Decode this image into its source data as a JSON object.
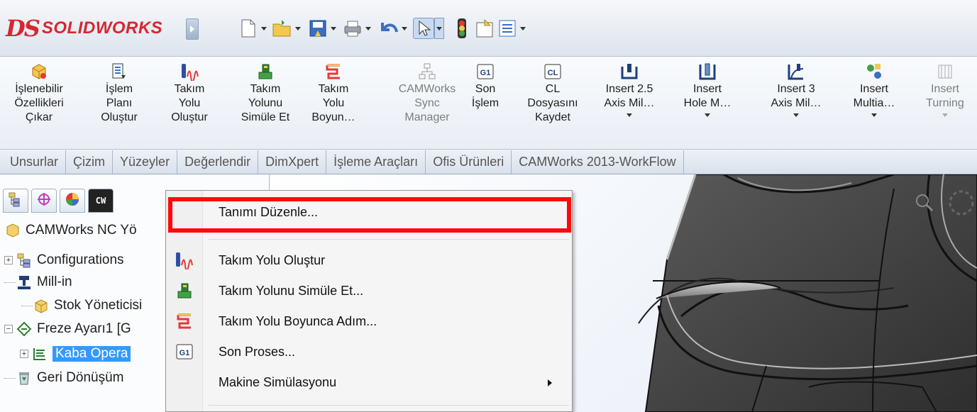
{
  "app": {
    "logo_ds": "DS",
    "logo_brand": "SOLIDWORKS"
  },
  "ribbon": [
    {
      "id": "islenebilir",
      "icon": "extract-features-icon",
      "lines": [
        "İşlenebilir",
        "Özellikleri",
        "Çıkar"
      ],
      "enabled": true
    },
    {
      "id": "islem-plani",
      "icon": "operation-plan-icon",
      "lines": [
        "İşlem",
        "Planı",
        "Oluştur"
      ],
      "enabled": true
    },
    {
      "id": "takim-yolu-olustur",
      "icon": "toolpath-icon",
      "lines": [
        "Takım",
        "Yolu",
        "Oluştur"
      ],
      "enabled": true
    },
    {
      "id": "takim-yolunu-simule",
      "icon": "simulate-toolpath-icon",
      "lines": [
        "Takım",
        "Yolunu",
        "Simüle Et"
      ],
      "enabled": true
    },
    {
      "id": "takim-yolu-boyunca",
      "icon": "step-through-toolpath-icon",
      "lines": [
        "Takım",
        "Yolu",
        "Boyun…"
      ],
      "enabled": true
    },
    {
      "id": "camworks-sync",
      "icon": "sync-manager-icon",
      "lines": [
        "CAMWorks",
        "Sync",
        "Manager"
      ],
      "enabled": false
    },
    {
      "id": "son-islem",
      "icon": "g1-post-process-icon",
      "lines": [
        "Son",
        "İşlem"
      ],
      "enabled": true
    },
    {
      "id": "cl-dosyasi",
      "icon": "cl-file-icon",
      "lines": [
        "CL",
        "Dosyasını",
        "Kaydet"
      ],
      "enabled": true
    },
    {
      "id": "insert-25",
      "icon": "insert-2-5-axis-icon",
      "lines": [
        "Insert 2.5",
        "Axis Mil…"
      ],
      "enabled": true,
      "dropdown": true
    },
    {
      "id": "insert-hole",
      "icon": "insert-hole-icon",
      "lines": [
        "Insert",
        "Hole M…"
      ],
      "enabled": true,
      "dropdown": true
    },
    {
      "id": "insert-3",
      "icon": "insert-3-axis-icon",
      "lines": [
        "Insert 3",
        "Axis Mil…"
      ],
      "enabled": true,
      "dropdown": true
    },
    {
      "id": "insert-multia",
      "icon": "insert-multiaxis-icon",
      "lines": [
        "Insert",
        "Multia…"
      ],
      "enabled": true,
      "dropdown": true
    },
    {
      "id": "insert-turning",
      "icon": "insert-turning-icon",
      "lines": [
        "Insert",
        "Turning"
      ],
      "enabled": false,
      "dropdown": true
    }
  ],
  "tabs": [
    "Unsurlar",
    "Çizim",
    "Yüzeyler",
    "Değerlendir",
    "DimXpert",
    "İşleme Araçları",
    "Ofis Ürünleri",
    "CAMWorks 2013-WorkFlow"
  ],
  "tree": {
    "root": "CAMWorks NC Yö",
    "items": [
      {
        "label": "Configurations",
        "icon": "configurations-icon",
        "expander": "+"
      },
      {
        "label": "Mill-in",
        "icon": "mill-machine-icon",
        "expander": ""
      },
      {
        "label": "Stok Yöneticisi",
        "icon": "stock-manager-icon",
        "expander": ""
      },
      {
        "label": "Freze Ayarı1 [G",
        "icon": "mill-setup-icon",
        "expander": "−"
      },
      {
        "label": "Kaba Opera",
        "icon": "rough-operation-icon",
        "expander": "+",
        "selected": true
      },
      {
        "label": "Geri Dönüşüm",
        "icon": "recycle-bin-icon",
        "expander": ""
      }
    ]
  },
  "menu": {
    "items": [
      {
        "label": "Tanımı Düzenle...",
        "icon": "",
        "highlighted": true
      },
      {
        "label": "Takım Yolu Oluştur",
        "icon": "toolpath-icon"
      },
      {
        "label": "Takım Yolunu Simüle Et...",
        "icon": "simulate-toolpath-icon"
      },
      {
        "label": "Takım Yolu Boyunca Adım...",
        "icon": "step-through-toolpath-icon"
      },
      {
        "label": "Son Proses...",
        "icon": "g1-post-process-icon"
      },
      {
        "label": "Makine Simülasyonu",
        "icon": "",
        "submenu": true
      }
    ]
  },
  "colors": {
    "highlight_box": "#ff0a0a",
    "selection": "#3399ff",
    "brand": "#d6282f"
  }
}
